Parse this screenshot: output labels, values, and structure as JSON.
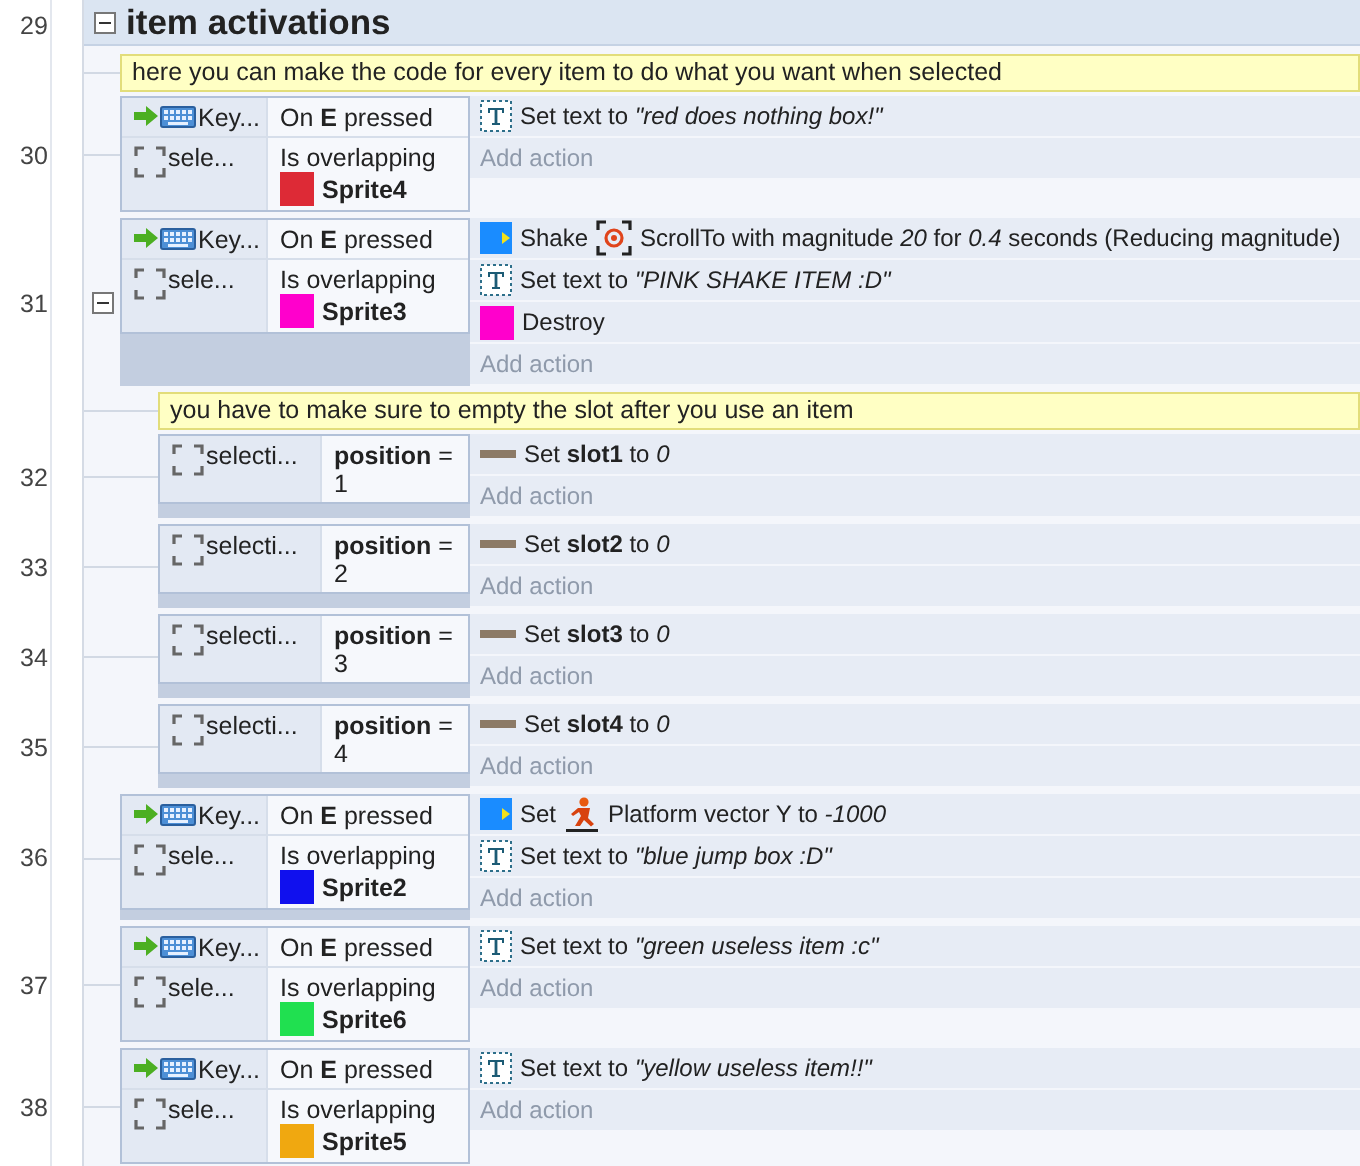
{
  "group": {
    "line": "29",
    "title": "item activations",
    "expanded": true
  },
  "items": [
    {
      "kind": "comment",
      "text": "here you can make the code for every item to do what you want when selected"
    },
    {
      "kind": "event",
      "line": "30",
      "conditions": [
        {
          "kind": "keyboard",
          "object": "Key...",
          "text": "On **E** pressed"
        },
        {
          "kind": "selection",
          "object": "sele...",
          "text": "Is overlapping",
          "sprite": {
            "name": "Sprite4",
            "color": "#dd2a36"
          }
        }
      ],
      "actions": [
        {
          "kind": "text",
          "text": "Set text to *\"red does nothing box!\"*"
        }
      ],
      "add_action": "Add action"
    },
    {
      "kind": "event",
      "line": "31",
      "expanded": true,
      "conditions": [
        {
          "kind": "keyboard",
          "object": "Key...",
          "text": "On **E** pressed"
        },
        {
          "kind": "selection",
          "object": "sele...",
          "text": "Is overlapping",
          "sprite": {
            "name": "Sprite3",
            "color": "#ff00cc"
          }
        }
      ],
      "actions": [
        {
          "kind": "behavior",
          "verb": "Shake",
          "target": {
            "kind": "crosshair"
          },
          "text": "ScrollTo with magnitude *20* for *0.4* seconds (Reducing magnitude)"
        },
        {
          "kind": "text",
          "text": "Set text to *\"PINK SHAKE ITEM :D\"*"
        },
        {
          "kind": "sprite",
          "color": "#ff00cc",
          "text": "Destroy"
        }
      ],
      "add_action": "Add action",
      "children": [
        {
          "kind": "comment",
          "text": "you have to make sure to empty the slot after you use an item"
        },
        {
          "kind": "event",
          "line": "32",
          "conditions": [
            {
              "kind": "selection",
              "object": "selecti...",
              "text": "**position** = 1"
            }
          ],
          "actions": [
            {
              "kind": "variable",
              "text": "Set **slot1** to *0*"
            }
          ],
          "add_action": "Add action"
        },
        {
          "kind": "event",
          "line": "33",
          "conditions": [
            {
              "kind": "selection",
              "object": "selecti...",
              "text": "**position** = 2"
            }
          ],
          "actions": [
            {
              "kind": "variable",
              "text": "Set **slot2** to *0*"
            }
          ],
          "add_action": "Add action"
        },
        {
          "kind": "event",
          "line": "34",
          "conditions": [
            {
              "kind": "selection",
              "object": "selecti...",
              "text": "**position** = 3"
            }
          ],
          "actions": [
            {
              "kind": "variable",
              "text": "Set **slot3** to *0*"
            }
          ],
          "add_action": "Add action"
        },
        {
          "kind": "event",
          "line": "35",
          "conditions": [
            {
              "kind": "selection",
              "object": "selecti...",
              "text": "**position** = 4"
            }
          ],
          "actions": [
            {
              "kind": "variable",
              "text": "Set **slot4** to *0*"
            }
          ],
          "add_action": "Add action"
        }
      ]
    },
    {
      "kind": "event",
      "line": "36",
      "conditions": [
        {
          "kind": "keyboard",
          "object": "Key...",
          "text": "On **E** pressed"
        },
        {
          "kind": "selection",
          "object": "sele...",
          "text": "Is overlapping",
          "sprite": {
            "name": "Sprite2",
            "color": "#1010ee"
          }
        }
      ],
      "actions": [
        {
          "kind": "behavior",
          "verb": "Set",
          "target": {
            "kind": "runner"
          },
          "text": "Platform vector Y to *-1000*"
        },
        {
          "kind": "text",
          "text": "Set text to *\"blue jump box :D\"*"
        }
      ],
      "add_action": "Add action"
    },
    {
      "kind": "event",
      "line": "37",
      "conditions": [
        {
          "kind": "keyboard",
          "object": "Key...",
          "text": "On **E** pressed"
        },
        {
          "kind": "selection",
          "object": "sele...",
          "text": "Is overlapping",
          "sprite": {
            "name": "Sprite6",
            "color": "#20e050"
          }
        }
      ],
      "actions": [
        {
          "kind": "text",
          "text": "Set text to *\"green useless item :c\"*"
        }
      ],
      "add_action": "Add action"
    },
    {
      "kind": "event",
      "line": "38",
      "conditions": [
        {
          "kind": "keyboard",
          "object": "Key...",
          "text": "On **E** pressed"
        },
        {
          "kind": "selection",
          "object": "sele...",
          "text": "Is overlapping",
          "sprite": {
            "name": "Sprite5",
            "color": "#f0a810"
          }
        }
      ],
      "actions": [
        {
          "kind": "text",
          "text": "Set text to *\"yellow useless item!!\"*"
        }
      ],
      "add_action": "Add action"
    }
  ]
}
